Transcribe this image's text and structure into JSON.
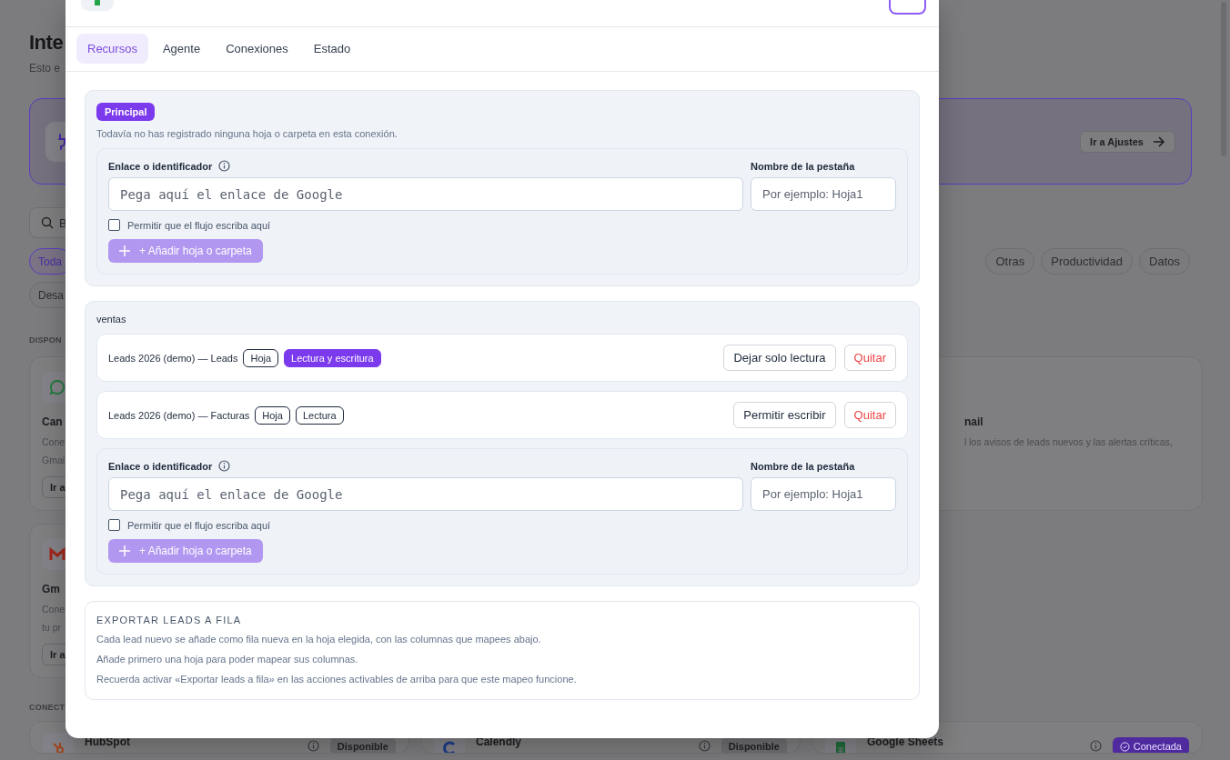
{
  "page": {
    "title": "Inte",
    "subtitle": "Esto e",
    "banner": {
      "button": "Ir a Ajustes"
    },
    "search": {
      "value": "B"
    },
    "filter_rows": [
      {
        "chips": [
          {
            "label": "Toda",
            "selected": true
          },
          {
            "label": "Otras",
            "selected": false
          },
          {
            "label": "Productividad",
            "selected": false
          },
          {
            "label": "Datos",
            "selected": false
          }
        ]
      },
      {
        "chips": [
          {
            "label": "Desa",
            "selected": false
          }
        ]
      }
    ],
    "section_1": "DISPON",
    "cards": [
      {
        "kind": "chat",
        "title": "Can",
        "lines": [
          "Cone",
          "Gmai"
        ],
        "button": "Ir a"
      },
      {
        "kind": "clipped",
        "title": "nail",
        "lines": [
          "l los avisos de leads nuevos y las alertas críticas,"
        ]
      },
      {
        "kind": "mail",
        "title": "Gm",
        "lines": [
          "Cone",
          "tu pr"
        ],
        "button": "Ir a"
      }
    ],
    "section_2": "CONECT",
    "connected_cards": [
      {
        "kind": "hub",
        "title": "HubSpot",
        "status": "Disponible",
        "connected": false
      },
      {
        "kind": "calendar",
        "title": "Calendly",
        "status": "Disponible",
        "connected": false
      },
      {
        "kind": "sheet",
        "title": "Google Sheets",
        "status": "Conectada",
        "connected": true
      }
    ]
  },
  "modal": {
    "tabs": [
      {
        "label": "Recursos",
        "selected": true
      },
      {
        "label": "Agente",
        "selected": false
      },
      {
        "label": "Conexiones",
        "selected": false
      },
      {
        "label": "Estado",
        "selected": false
      }
    ],
    "groups": [
      {
        "kind": "principal",
        "badge": "Principal",
        "note": "Todavía no has registrado ninguna hoja o carpeta en esta conexión.",
        "form": {
          "link_label": "Enlace o identificador",
          "link_placeholder": "Pega aquí el enlace de Google",
          "tab_label": "Nombre de la pestaña",
          "tab_placeholder": "Por ejemplo: Hoja1",
          "write_label": "Permitir que el flujo escriba aquí",
          "write_checked": false,
          "add_button": "+ Añadir hoja o carpeta",
          "add_disabled": true
        }
      },
      {
        "kind": "named",
        "name": "ventas",
        "resources": [
          {
            "name": "Leads 2026 (demo) — Leads",
            "type": "Hoja",
            "access": "Lectura y escritura",
            "writable": true,
            "actions": [
              {
                "label": "Dejar solo lectura",
                "kind": "toggle"
              },
              {
                "label": "Quitar",
                "kind": "remove"
              }
            ]
          },
          {
            "name": "Leads 2026 (demo) — Facturas",
            "type": "Hoja",
            "access": "Lectura",
            "writable": false,
            "actions": [
              {
                "label": "Permitir escribir",
                "kind": "toggle"
              },
              {
                "label": "Quitar",
                "kind": "remove"
              }
            ]
          }
        ],
        "form": {
          "link_label": "Enlace o identificador",
          "link_placeholder": "Pega aquí el enlace de Google",
          "tab_label": "Nombre de la pestaña",
          "tab_placeholder": "Por ejemplo: Hoja1",
          "write_label": "Permitir que el flujo escriba aquí",
          "write_checked": false,
          "add_button": "+ Añadir hoja o carpeta",
          "add_disabled": true
        }
      }
    ],
    "export": {
      "title": "EXPORTAR LEADS A FILA",
      "lines": [
        "Cada lead nuevo se añade como fila nueva en la hoja elegida, con las columnas que mapees abajo.",
        "Añade primero una hoja para poder mapear sus columnas.",
        "Recuerda activar «Exportar leads a fila» en las acciones activables de arriba para que este mapeo funcione."
      ]
    }
  }
}
